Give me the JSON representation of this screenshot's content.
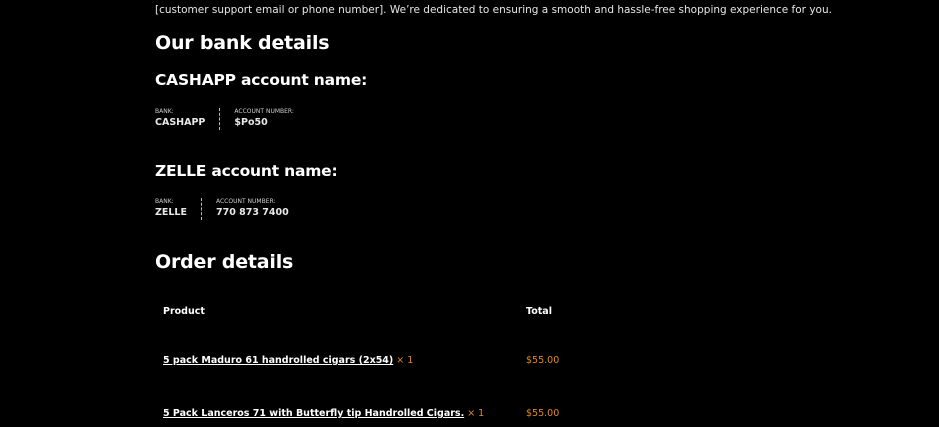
{
  "intro_text": "[customer support email or phone number]. We’re dedicated to ensuring a smooth and hassle-free shopping experience for you.",
  "bank_details": {
    "heading": "Our bank details",
    "accounts": [
      {
        "name_heading": "CASHAPP account name:",
        "bank_label": "BANK:",
        "bank_value": "CASHAPP",
        "account_label": "ACCOUNT NUMBER:",
        "account_value": "$Po50"
      },
      {
        "name_heading": "ZELLE account name:",
        "bank_label": "BANK:",
        "bank_value": "ZELLE",
        "account_label": "ACCOUNT NUMBER:",
        "account_value": "770 873 7400"
      }
    ]
  },
  "order_details": {
    "heading": "Order details",
    "columns": {
      "product": "Product",
      "total": "Total"
    },
    "items": [
      {
        "name": "5 pack Maduro 61 handrolled cigars (2x54)",
        "qty": "× 1",
        "total": "$55.00"
      },
      {
        "name": "5 Pack Lanceros 71 with Butterfly tip Handrolled Cigars.",
        "qty": "× 1",
        "total": "$55.00"
      }
    ]
  },
  "colors": {
    "background": "#000000",
    "text": "#ffffff",
    "accent_price": "#e0882a"
  }
}
